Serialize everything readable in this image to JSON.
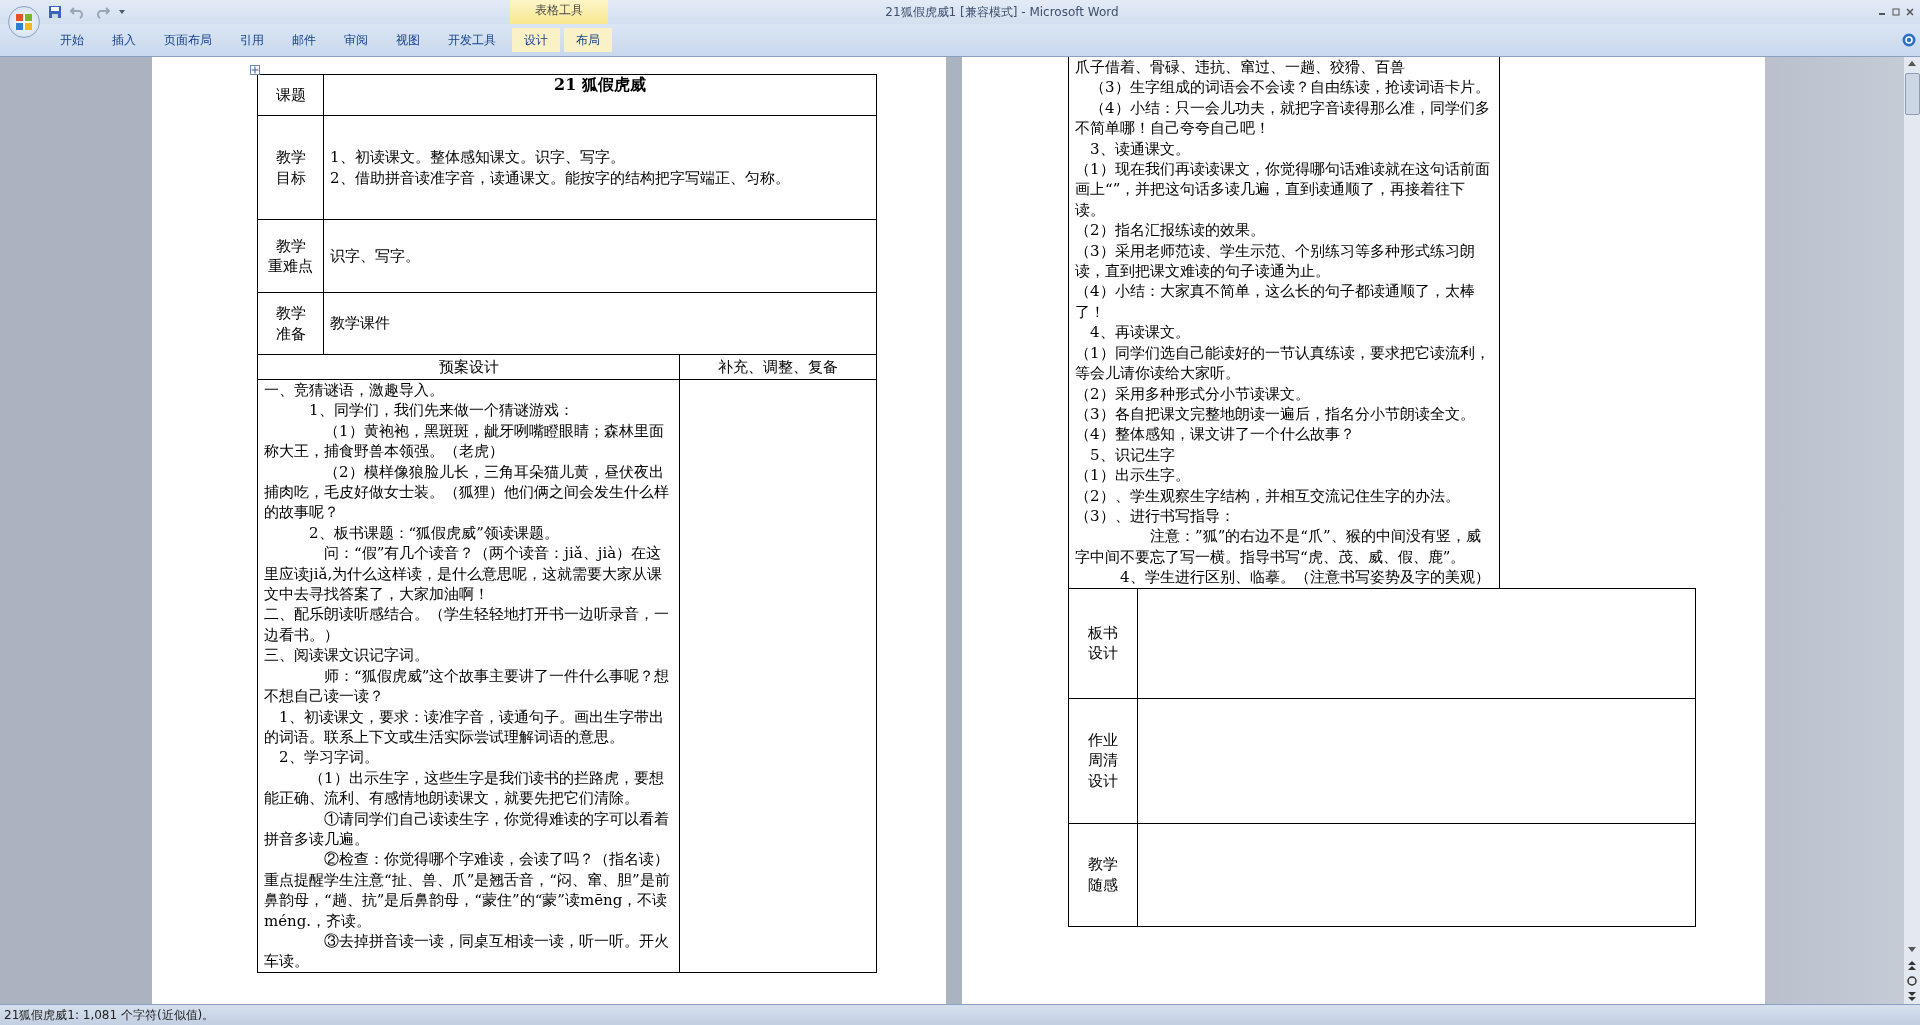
{
  "window": {
    "title": "21狐假虎威1 [兼容模式] - Microsoft Word"
  },
  "ribbon": {
    "contextual_group": "表格工具",
    "tabs": [
      {
        "label": "开始",
        "contextual": false
      },
      {
        "label": "插入",
        "contextual": false
      },
      {
        "label": "页面布局",
        "contextual": false
      },
      {
        "label": "引用",
        "contextual": false
      },
      {
        "label": "邮件",
        "contextual": false
      },
      {
        "label": "审阅",
        "contextual": false
      },
      {
        "label": "视图",
        "contextual": false
      },
      {
        "label": "开发工具",
        "contextual": false
      },
      {
        "label": "设计",
        "contextual": true
      },
      {
        "label": "布局",
        "contextual": true
      }
    ]
  },
  "left_page": {
    "title_row": {
      "label": "课题",
      "title": "21 狐假虎威"
    },
    "info_rows": [
      {
        "label_lines": [
          "教学",
          "目标"
        ],
        "lines": [
          "1、初读课文。整体感知课文。识字、写字。",
          "2、借助拼音读准字音，读通课文。能按字的结构把字写端正、匀称。"
        ]
      },
      {
        "label_lines": [
          "教学",
          "重难点"
        ],
        "lines": [
          "识字、写字。"
        ]
      },
      {
        "label_lines": [
          "教学",
          "准备"
        ],
        "lines": [
          "教学课件"
        ]
      }
    ],
    "design_header": "预案设计",
    "notes_header": "补充、调整、复备",
    "paragraphs": [
      {
        "kind": "flush",
        "text": "一、竞猜谜语，激趣导入。"
      },
      {
        "kind": "step",
        "text": "1、同学们，我们先来做一个猜谜游戏："
      },
      {
        "kind": "sub",
        "text": "（1）黄袍袍，黑斑斑，龇牙咧嘴瞪眼睛；森林里面称大王，捕食野兽本领强。（老虎）"
      },
      {
        "kind": "sub",
        "text": "（2）模样像狼脸儿长，三角耳朵猫儿黄，昼伏夜出捕肉吃，毛皮好做女士装。（狐狸）他们俩之间会发生什么样的故事呢？"
      },
      {
        "kind": "step",
        "text": "2、板书课题：“狐假虎威”领读课题。"
      },
      {
        "kind": "sub",
        "text": "问：“假”有几个读音？（两个读音：jiǎ、jià）在这里应读jiǎ,为什么这样读，是什么意思呢，这就需要大家从课文中去寻找答案了，大家加油啊！"
      },
      {
        "kind": "flush",
        "text": "二、配乐朗读听感结合。（学生轻轻地打开书一边听录音，一边看书。）"
      },
      {
        "kind": "flush",
        "text": "三、阅读课文识记字词。"
      },
      {
        "kind": "sub",
        "text": "师：“狐假虎威”这个故事主要讲了一件什么事呢？想不想自己读一读？"
      },
      {
        "kind": "item",
        "text": "1、初读课文，要求：读准字音，读通句子。画出生字带出的词语。联系上下文或生活实际尝试理解词语的意思。"
      },
      {
        "kind": "item",
        "text": "2、学习字词。"
      },
      {
        "kind": "step",
        "text": "（1）出示生字，这些生字是我们读书的拦路虎，要想能正确、流利、有感情地朗读课文，就要先把它们清除。"
      },
      {
        "kind": "sub",
        "text": "①请同学们自己读读生字，你觉得难读的字可以看着拼音多读几遍。"
      },
      {
        "kind": "sub",
        "text": "②检查：你觉得哪个字难读，会读了吗？（指名读）重点提醒学生注意“扯、兽、爪”是翘舌音，“闷、窜、胆”是前鼻韵母，“趟、抗”是后鼻韵母，“蒙住”的“蒙”读mēng，不读méng.，齐读。"
      },
      {
        "kind": "sub",
        "text": "③去掉拼音读一读，同桌互相读一读，听一听。开火车读。"
      }
    ]
  },
  "right_page": {
    "paragraphs": [
      {
        "kind": "flush",
        "text": "爪子借着、骨碌、违抗、窜过、一趟、狡猾、百兽"
      },
      {
        "kind": "item",
        "text": "（3）生字组成的词语会不会读？自由练读，抢读词语卡片。"
      },
      {
        "kind": "item",
        "text": "（4）小结：只一会儿功夫，就把字音读得那么准，同学们多不简单哪！自己夸夸自己吧！"
      },
      {
        "kind": "item",
        "text": "3、读通课文。"
      },
      {
        "kind": "flush",
        "text": "（1）现在我们再读读课文，你觉得哪句话难读就在这句话前面画上“”，并把这句话多读几遍，直到读通顺了，再接着往下读。"
      },
      {
        "kind": "flush",
        "text": "（2）指名汇报练读的效果。"
      },
      {
        "kind": "flush",
        "text": "（3）采用老师范读、学生示范、个别练习等多种形式练习朗读，直到把课文难读的句子读通为止。"
      },
      {
        "kind": "flush",
        "text": "（4）小结：大家真不简单，这么长的句子都读通顺了，太棒了！"
      },
      {
        "kind": "item",
        "text": "4、再读课文。"
      },
      {
        "kind": "flush",
        "text": "（1）同学们选自己能读好的一节认真练读，要求把它读流利，等会儿请你读给大家听。"
      },
      {
        "kind": "flush",
        "text": "（2）采用多种形式分小节读课文。"
      },
      {
        "kind": "flush",
        "text": "（3）各自把课文完整地朗读一遍后，指名分小节朗读全文。"
      },
      {
        "kind": "flush",
        "text": "（4）整体感知，课文讲了一个什么故事？"
      },
      {
        "kind": "item",
        "text": "5、识记生字"
      },
      {
        "kind": "flush",
        "text": "（1）出示生字。"
      },
      {
        "kind": "flush",
        "text": "（2）、学生观察生字结构，并相互交流记住生字的办法。"
      },
      {
        "kind": "flush",
        "text": "（3）、进行书写指导："
      },
      {
        "kind": "deep",
        "text": "注意：”狐”的右边不是“爪”、猴的中间没有竖，威字中间不要忘了写一横。指导书写“虎、茂、威、假、鹿”。"
      },
      {
        "kind": "step",
        "text": "4、学生进行区别、临摹。（注意书写姿势及字的美观）"
      }
    ],
    "bottom_rows": [
      {
        "label_lines": [
          "板书",
          "设计"
        ]
      },
      {
        "label_lines": [
          "作业",
          "周清",
          "设计"
        ]
      },
      {
        "label_lines": [
          "教学",
          "随感"
        ]
      }
    ]
  },
  "status_bar": {
    "text": "21狐假虎威1: 1,081 个字符(近似值)。"
  }
}
